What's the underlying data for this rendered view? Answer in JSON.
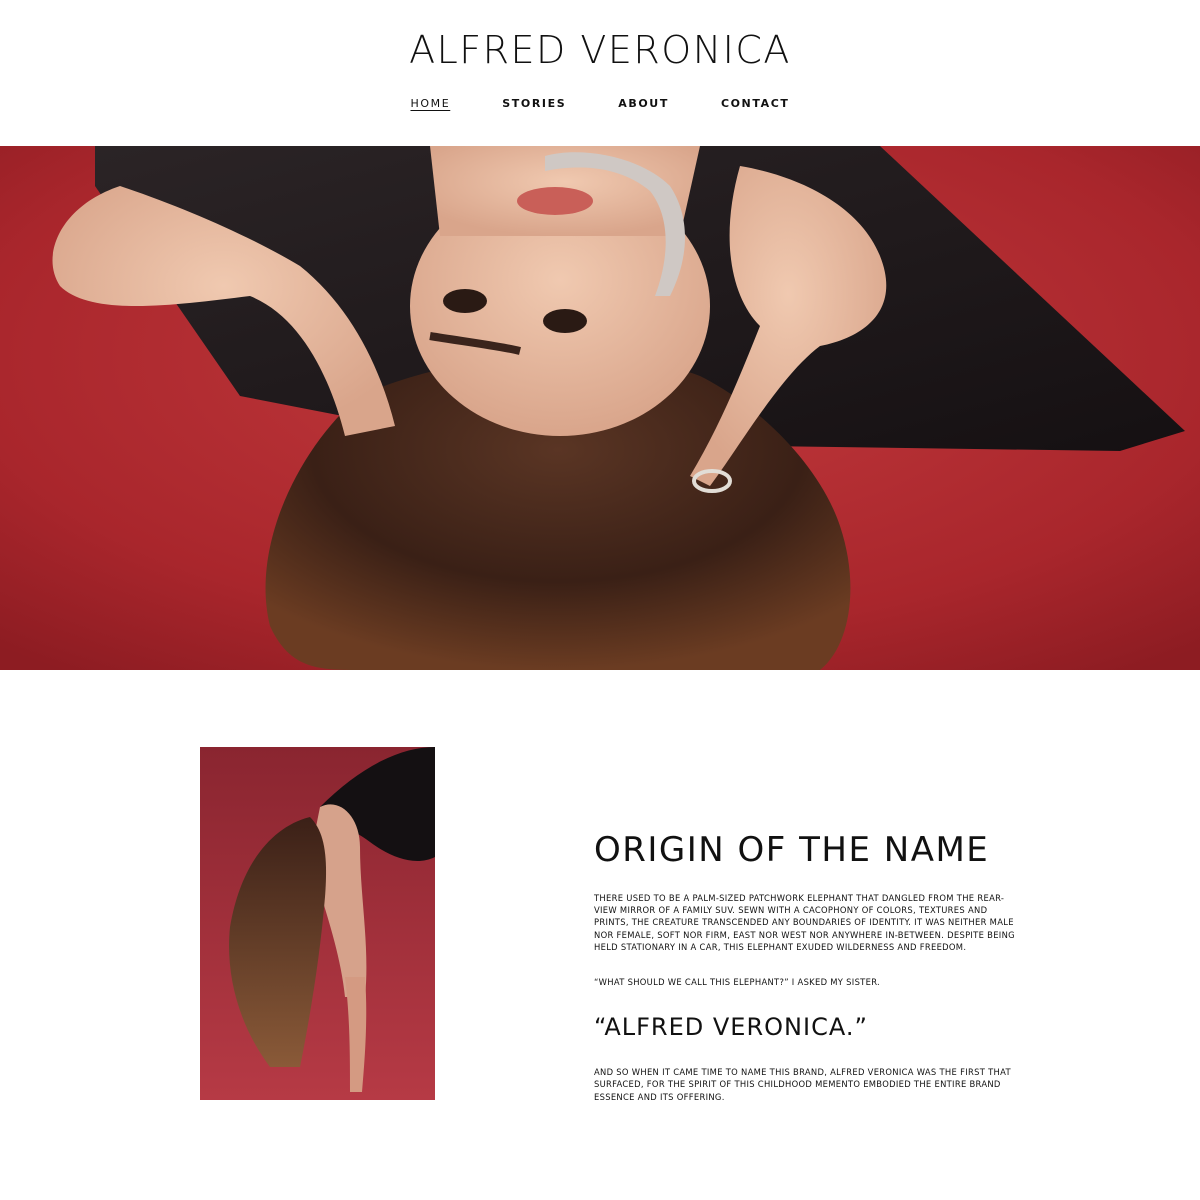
{
  "header": {
    "brand": "ALFRED VERONICA",
    "nav": [
      {
        "label": "HOME",
        "active": true
      },
      {
        "label": "STORIES",
        "active": false
      },
      {
        "label": "ABOUT",
        "active": false
      },
      {
        "label": "CONTACT",
        "active": false
      }
    ]
  },
  "hero": {
    "image": "woman-lying-on-red-floor-photo"
  },
  "portrait": {
    "image": "woman-bending-forward-portrait-photo"
  },
  "story": {
    "title": "ORIGIN OF THE NAME",
    "paragraph_1": "There used to be a palm-sized patchwork elephant that dangled from the rear-view mirror of a family SUV. Sewn with a cacophony of colors, textures and prints, the creature transcended any boundaries of identity. It was neither male nor female, soft nor firm, east nor west nor anywhere in-between. Despite being held stationary in a car, this elephant exuded wilderness and freedom.",
    "paragraph_2": "“What should we call this elephant?” I asked my sister.",
    "quote": "“ALFRED VERONICA.”",
    "paragraph_3": "And so when it came time to name this brand, Alfred Veronica was the first that surfaced, for the spirit of this childhood memento embodied the entire brand essence and its offering."
  },
  "colors": {
    "background": "#ffffff",
    "text": "#111111",
    "hero_red": "#b02a2f",
    "portrait_red": "#a1303a"
  }
}
